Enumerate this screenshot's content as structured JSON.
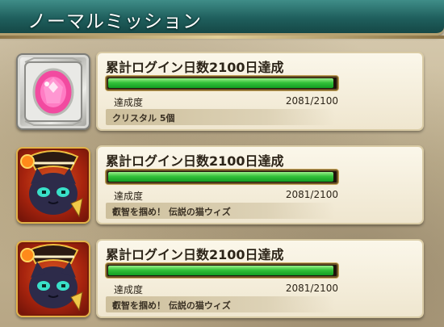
{
  "header": {
    "title": "ノーマルミッション"
  },
  "missions": [
    {
      "title": "累計ログイン日数2100日達成",
      "progress_label": "達成度",
      "progress_text": "2081/2100",
      "progress_fraction": 0.991,
      "reward": "クリスタル 5個",
      "reward_icon": "crystal-gem-icon",
      "frame_color": "#c8c8c4"
    },
    {
      "title": "累計ログイン日数2100日達成",
      "progress_label": "達成度",
      "progress_text": "2081/2100",
      "progress_fraction": 0.991,
      "reward": "叡智を掴め！ 伝説の猫ウィズ",
      "reward_icon": "cat-wiz-card-icon",
      "frame_color": "#b02a10"
    },
    {
      "title": "累計ログイン日数2100日達成",
      "progress_label": "達成度",
      "progress_text": "2081/2100",
      "progress_fraction": 0.991,
      "reward": "叡智を掴め！ 伝説の猫ウィズ",
      "reward_icon": "cat-wiz-card-icon",
      "frame_color": "#b02a10"
    }
  ]
}
